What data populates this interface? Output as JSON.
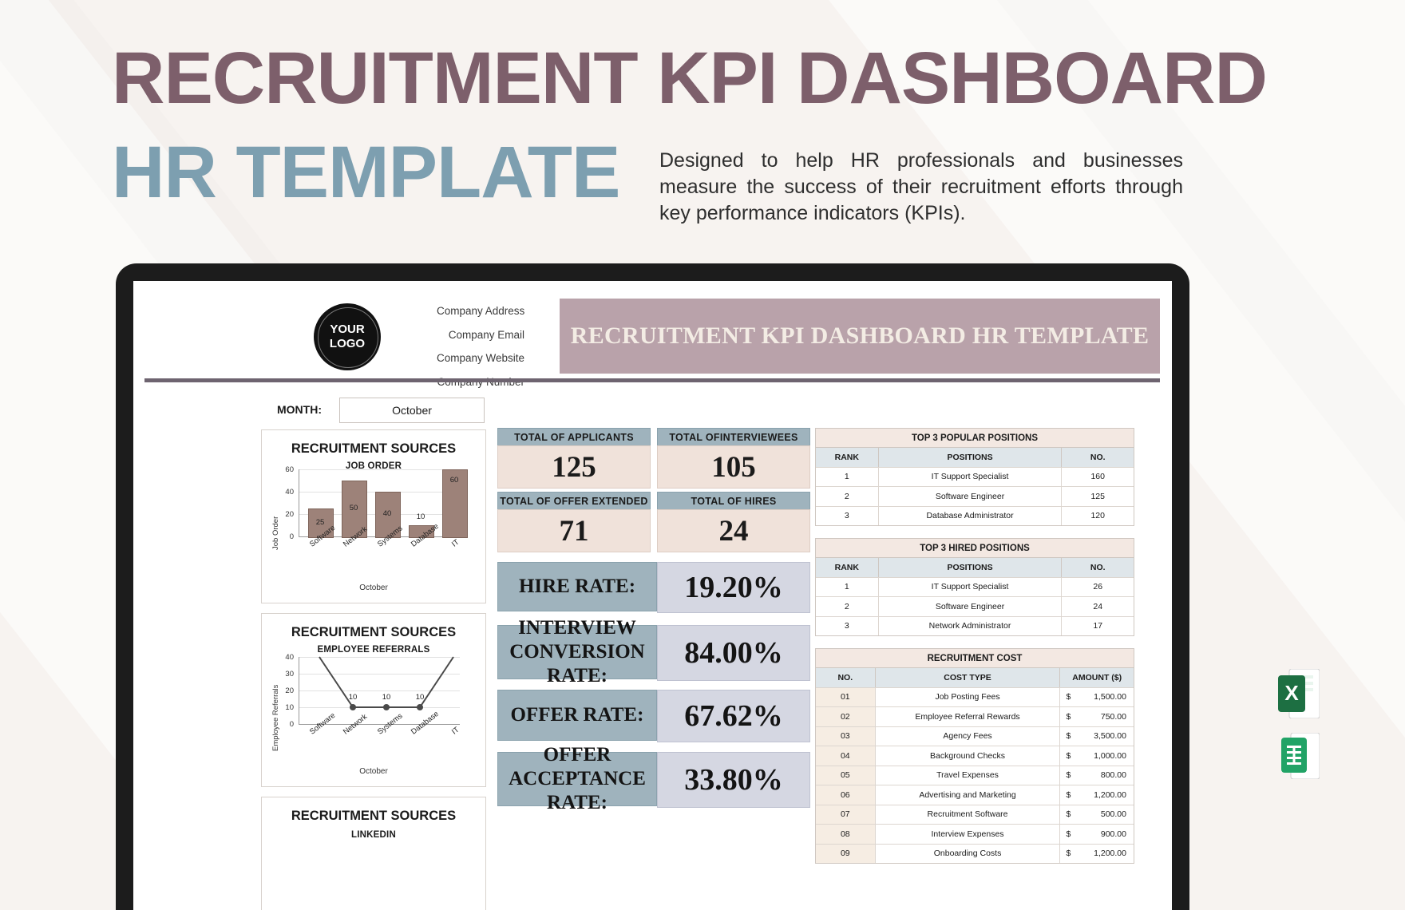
{
  "header": {
    "title_line1": "RECRUITMENT KPI DASHBOARD",
    "title_line2": "HR TEMPLATE",
    "subtitle": "Designed to help HR professionals and businesses measure the success of their recruitment efforts through key performance indicators (KPIs).",
    "color_title1": "#7d5f6b",
    "color_title2": "#7d9fb0"
  },
  "sheet": {
    "logo_line1": "YOUR",
    "logo_line2": "LOGO",
    "company": [
      "Company Address",
      "Company Email",
      "Company Website",
      "Company Number"
    ],
    "banner_title": "RECRUITMENT KPI DASHBOARD HR TEMPLATE",
    "month_label": "MONTH:",
    "month_value": "October"
  },
  "charts": [
    {
      "type": "bar",
      "title": "RECRUITMENT SOURCES",
      "subtitle": "JOB ORDER",
      "ylabel": "Job Order",
      "xlabel": "October",
      "categories": [
        "Software",
        "Network",
        "Systems",
        "Database",
        "IT"
      ],
      "values": [
        25,
        50,
        40,
        10,
        60
      ],
      "ticks": [
        "0",
        "20",
        "40",
        "60"
      ],
      "ylim": [
        0,
        60
      ]
    },
    {
      "type": "line",
      "title": "RECRUITMENT SOURCES",
      "subtitle": "EMPLOYEE REFERRALS",
      "ylabel": "Employee Referrals",
      "xlabel": "October",
      "categories": [
        "Software",
        "Network",
        "Systems",
        "Database",
        "IT"
      ],
      "values": [
        40,
        10,
        10,
        10,
        40
      ],
      "ticks": [
        "0",
        "10",
        "20",
        "30",
        "40"
      ],
      "ylim": [
        0,
        40
      ],
      "point_labels": [
        "",
        "10",
        "10",
        "10",
        ""
      ]
    },
    {
      "type": "bar",
      "title": "RECRUITMENT SOURCES",
      "subtitle": "LINKEDIN"
    }
  ],
  "kpis": [
    {
      "label": "TOTAL OF APPLICANTS",
      "value": "125"
    },
    {
      "label": "TOTAL OFINTERVIEWEES",
      "value": "105"
    },
    {
      "label": "TOTAL OF OFFER EXTENDED",
      "value": "71"
    },
    {
      "label": "TOTAL OF HIRES",
      "value": "24"
    }
  ],
  "rates": [
    {
      "label": "HIRE RATE:",
      "value": "19.20%"
    },
    {
      "label": "INTERVIEW CONVERSION RATE:",
      "value": "84.00%"
    },
    {
      "label": "OFFER RATE:",
      "value": "67.62%"
    },
    {
      "label": "OFFER ACCEPTANCE RATE:",
      "value": "33.80%"
    }
  ],
  "tables": {
    "popular": {
      "title": "TOP 3 POPULAR POSITIONS",
      "headers": [
        "RANK",
        "POSITIONS",
        "NO."
      ],
      "rows": [
        [
          "1",
          "IT Support Specialist",
          "160"
        ],
        [
          "2",
          "Software Engineer",
          "125"
        ],
        [
          "3",
          "Database Administrator",
          "120"
        ]
      ]
    },
    "hired": {
      "title": "TOP 3 HIRED POSITIONS",
      "headers": [
        "RANK",
        "POSITIONS",
        "NO."
      ],
      "rows": [
        [
          "1",
          "IT Support Specialist",
          "26"
        ],
        [
          "2",
          "Software Engineer",
          "24"
        ],
        [
          "3",
          "Network Administrator",
          "17"
        ]
      ]
    },
    "cost": {
      "title": "RECRUITMENT COST",
      "headers": [
        "NO.",
        "COST TYPE",
        "AMOUNT ($)"
      ],
      "currency": "$",
      "rows": [
        [
          "01",
          "Job Posting Fees",
          "1,500.00"
        ],
        [
          "02",
          "Employee Referral Rewards",
          "750.00"
        ],
        [
          "03",
          "Agency Fees",
          "3,500.00"
        ],
        [
          "04",
          "Background Checks",
          "1,000.00"
        ],
        [
          "05",
          "Travel Expenses",
          "800.00"
        ],
        [
          "06",
          "Advertising and Marketing",
          "1,200.00"
        ],
        [
          "07",
          "Recruitment Software",
          "500.00"
        ],
        [
          "08",
          "Interview Expenses",
          "900.00"
        ],
        [
          "09",
          "Onboarding Costs",
          "1,200.00"
        ]
      ]
    }
  },
  "file_icons": [
    {
      "name": "excel-file-icon",
      "letter": "X",
      "color": "#1d6f42"
    },
    {
      "name": "google-sheets-file-icon",
      "letter": "",
      "color": "#21a366"
    }
  ]
}
